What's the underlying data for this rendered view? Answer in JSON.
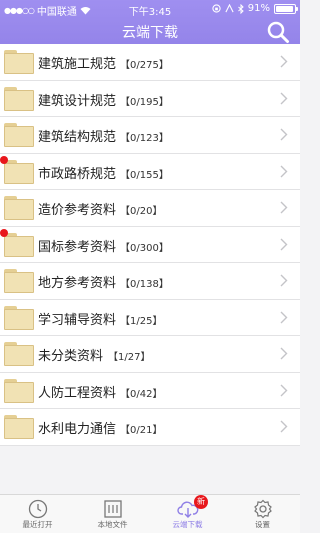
{
  "status_bar": {
    "carrier": "中国联通",
    "time": "下午3:45",
    "battery": "91%",
    "battery_level": 0.91
  },
  "header": {
    "title": "云端下载"
  },
  "folders": [
    {
      "name": "建筑施工规范",
      "count": "【0/275】",
      "new_dot": false
    },
    {
      "name": "建筑设计规范",
      "count": "【0/195】",
      "new_dot": false
    },
    {
      "name": "建筑结构规范",
      "count": "【0/123】",
      "new_dot": false
    },
    {
      "name": "市政路桥规范",
      "count": "【0/155】",
      "new_dot": true
    },
    {
      "name": "造价参考资料",
      "count": "【0/20】",
      "new_dot": false
    },
    {
      "name": "国标参考资料",
      "count": "【0/300】",
      "new_dot": true
    },
    {
      "name": "地方参考资料",
      "count": "【0/138】",
      "new_dot": false
    },
    {
      "name": "学习辅导资料",
      "count": "【1/25】",
      "new_dot": false
    },
    {
      "name": "未分类资料",
      "count": "【1/27】",
      "new_dot": false
    },
    {
      "name": "人防工程资料",
      "count": "【0/42】",
      "new_dot": false
    },
    {
      "name": "水利电力通信",
      "count": "【0/21】",
      "new_dot": false
    }
  ],
  "tabbar": {
    "recent": "最近打开",
    "local": "本地文件",
    "cloud": "云端下载",
    "cloud_badge": "新",
    "settings": "设置"
  },
  "colors": {
    "accent": "#8f7fe6",
    "badge": "#e8171c",
    "folder": "#f1e2b4"
  },
  "icons": [
    "search-icon",
    "folder-icon",
    "chevron-right-icon",
    "clock-icon",
    "book-icon",
    "cloud-download-icon",
    "gear-icon"
  ]
}
